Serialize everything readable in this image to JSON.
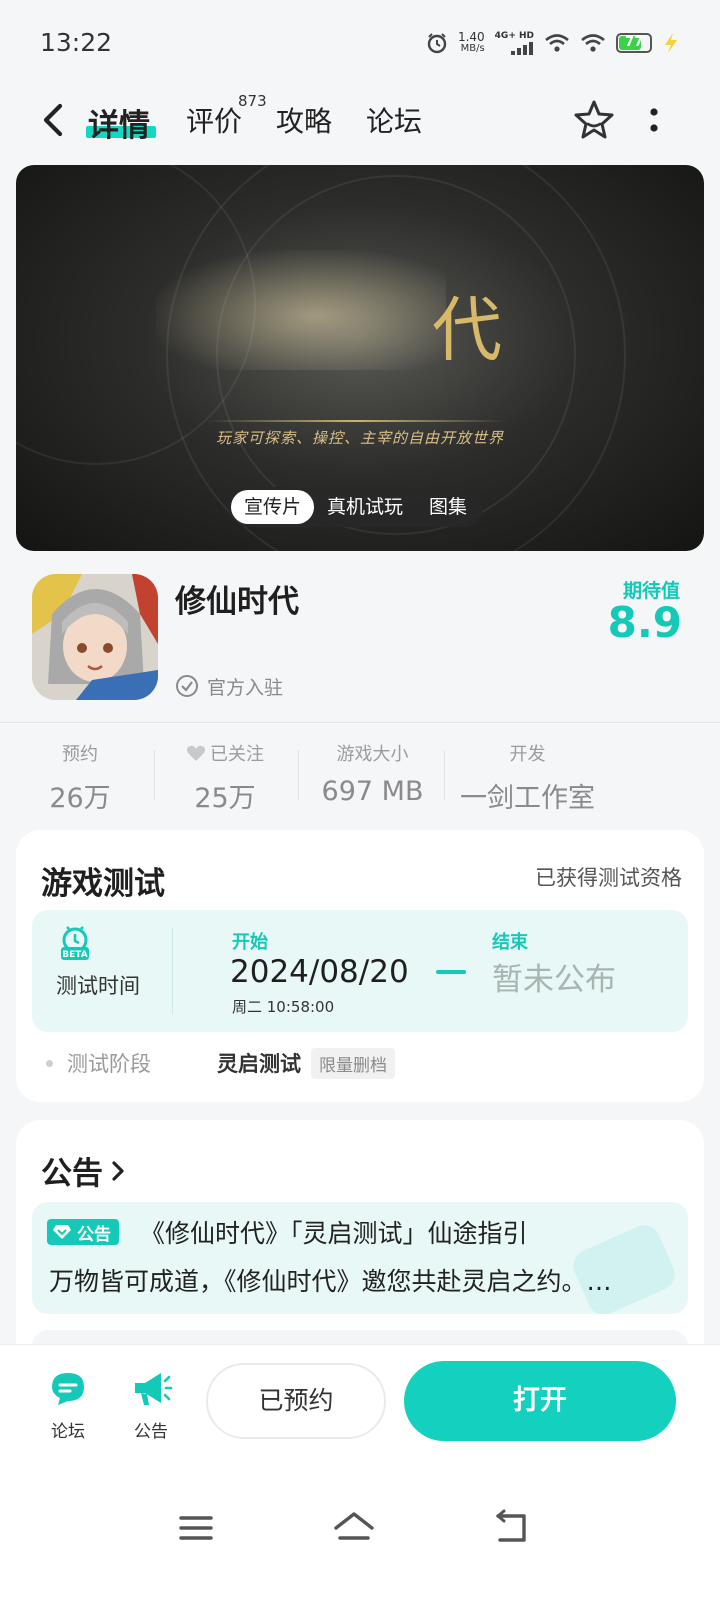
{
  "status_bar": {
    "time": "13:22",
    "net_speed_value": "1.40",
    "net_speed_unit": "MB/s",
    "network": "4G+ HD",
    "battery": "77",
    "icons": [
      "alarm-icon",
      "signal-icon",
      "wifi-icon",
      "wifi-icon",
      "battery-icon",
      "charging-icon"
    ]
  },
  "header": {
    "tabs": [
      {
        "label": "详情",
        "active": true
      },
      {
        "label": "评价",
        "badge": "873"
      },
      {
        "label": "攻略"
      },
      {
        "label": "论坛"
      }
    ],
    "icons": [
      "back-icon",
      "star-icon",
      "more-icon"
    ]
  },
  "media": {
    "slogan": "玩家可探索、操控、主宰的自由开放世界",
    "logo_glyph": "代",
    "segments": [
      "宣传片",
      "真机试玩",
      "图集"
    ],
    "active_segment": 0
  },
  "game": {
    "name": "修仙时代",
    "official_label": "官方入驻",
    "expect_label": "期待值",
    "expect_value": "8.9"
  },
  "stats": [
    {
      "label": "预约",
      "value": "26万"
    },
    {
      "label": "已关注",
      "value": "25万",
      "icon": "heart-icon"
    },
    {
      "label": "游戏大小",
      "value": "697 MB"
    },
    {
      "label": "开发",
      "value": "一剑工作室"
    }
  ],
  "test_card": {
    "title": "游戏测试",
    "qualification": "已获得测试资格",
    "beta_badge": "BETA",
    "time_label": "测试时间",
    "start_label": "开始",
    "start_date": "2024/08/20",
    "start_time": "周二  10:58:00",
    "end_label": "结束",
    "end_value": "暂未公布",
    "stage_label": "测试阶段",
    "stage_name": "灵启测试",
    "stage_tag": "限量删档"
  },
  "notice_card": {
    "title": "公告",
    "tag": "公告",
    "item_title": "《修仙时代》「灵启测试」仙途指引",
    "item_body": "万物皆可成道，《修仙时代》邀您共赴灵启之约。…"
  },
  "bottom_bar": {
    "forum_label": "论坛",
    "notice_label": "公告",
    "reserved_label": "已预约",
    "open_label": "打开"
  },
  "colors": {
    "accent": "#14c9b7",
    "open_button": "#14d0be",
    "test_box_bg": "#e7f8f6"
  }
}
